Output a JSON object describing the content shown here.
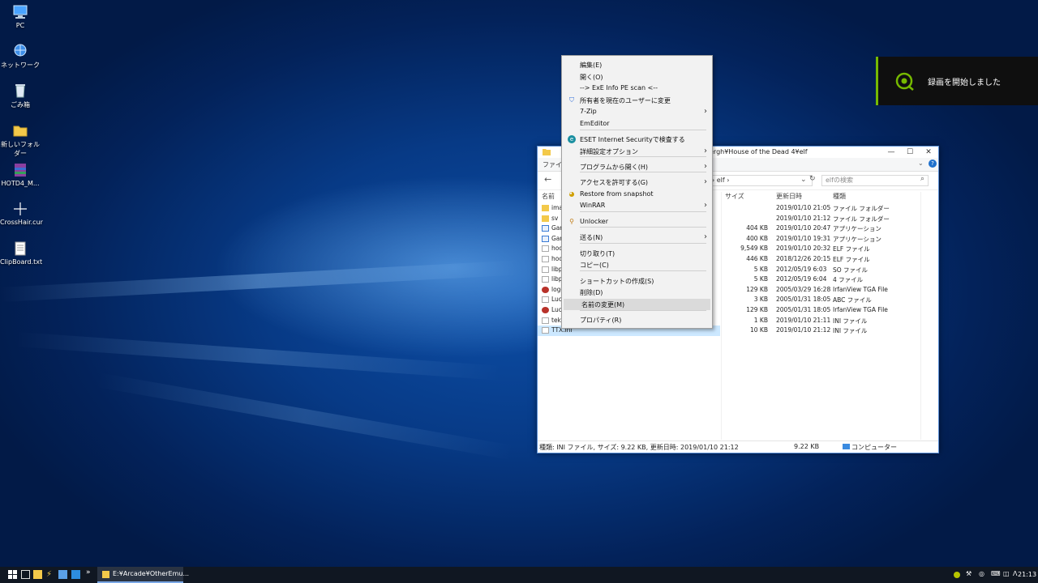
{
  "desktop": {
    "icons": [
      {
        "label": "PC",
        "icon": "pc-icon"
      },
      {
        "label": "ネットワーク",
        "icon": "network-icon"
      },
      {
        "label": "ごみ箱",
        "icon": "recycle-bin-icon"
      },
      {
        "label": "新しいフォルダー",
        "icon": "folder-icon"
      },
      {
        "label": "HOTD4_M...",
        "icon": "winrar-archive-icon"
      },
      {
        "label": "CrossHair.cur",
        "icon": "cursor-file-icon"
      },
      {
        "label": "ClipBoard.txt",
        "icon": "text-file-icon"
      }
    ]
  },
  "explorer": {
    "title_path": "ergh¥House of the Dead 4¥elf",
    "ribbon_file": "ファイル",
    "address_tail": "elf",
    "search_placeholder": "elfの検索",
    "columns": {
      "name": "名前",
      "size": "サイズ",
      "date": "更新日時",
      "type": "種類"
    },
    "files": [
      {
        "name": "ima",
        "size": "",
        "date": "2019/01/10 21:05",
        "type": "ファイル フォルダー",
        "icon": "folder"
      },
      {
        "name": "sv",
        "size": "",
        "date": "2019/01/10 21:12",
        "type": "ファイル フォルダー",
        "icon": "folder"
      },
      {
        "name": "Gar",
        "size": "404 KB",
        "date": "2019/01/10 20:47",
        "type": "アプリケーション",
        "icon": "app"
      },
      {
        "name": "Gar",
        "size": "400 KB",
        "date": "2019/01/10 19:31",
        "type": "アプリケーション",
        "icon": "app"
      },
      {
        "name": "hoc",
        "size": "9,549 KB",
        "date": "2019/01/10 20:32",
        "type": "ELF ファイル",
        "icon": "file"
      },
      {
        "name": "hoc",
        "size": "446 KB",
        "date": "2018/12/26 20:15",
        "type": "ELF ファイル",
        "icon": "file"
      },
      {
        "name": "libp",
        "size": "5 KB",
        "date": "2012/05/19 6:03",
        "type": "SO ファイル",
        "icon": "file"
      },
      {
        "name": "libp",
        "size": "5 KB",
        "date": "2012/05/19 6:04",
        "type": "4 ファイル",
        "icon": "file"
      },
      {
        "name": "logo",
        "size": "129 KB",
        "date": "2005/03/29 16:28",
        "type": "IrfanView TGA File",
        "icon": "tga"
      },
      {
        "name": "Luc",
        "size": "3 KB",
        "date": "2005/01/31 18:05",
        "type": "ABC ファイル",
        "icon": "file"
      },
      {
        "name": "Luc",
        "size": "129 KB",
        "date": "2005/01/31 18:05",
        "type": "IrfanView TGA File",
        "icon": "tga"
      },
      {
        "name": "tekr",
        "size": "1 KB",
        "date": "2019/01/10 21:11",
        "type": "INI ファイル",
        "icon": "file"
      },
      {
        "name": "TTX.ini",
        "size": "10 KB",
        "date": "2019/01/10 21:12",
        "type": "INI ファイル",
        "icon": "file"
      }
    ],
    "status_left": "種類: INI ファイル, サイズ: 9.22 KB, 更新日時: 2019/01/10 21:12",
    "status_size": "9.22 KB",
    "status_location": "コンピューター"
  },
  "context_menu": {
    "items": [
      {
        "label": "編集(E)"
      },
      {
        "label": "開く(O)"
      },
      {
        "label": "--> ExE Info  PE scan  <--"
      },
      {
        "label": "所有者を現在のユーザーに変更",
        "icon": "uac-shield-icon"
      },
      {
        "label": "7-Zip",
        "submenu": true
      },
      {
        "label": "EmEditor"
      },
      {
        "label": "ESET Internet Securityで検査する",
        "icon": "eset-icon"
      },
      {
        "label": "詳細設定オプション",
        "submenu": true
      },
      {
        "label": "プログラムから開く(H)",
        "submenu": true
      },
      {
        "label": "アクセスを許可する(G)",
        "submenu": true
      },
      {
        "label": "Restore from snapshot",
        "icon": "snapshot-icon"
      },
      {
        "label": "WinRAR",
        "submenu": true
      },
      {
        "label": "Unlocker",
        "icon": "unlocker-icon"
      },
      {
        "label": "送る(N)",
        "submenu": true
      },
      {
        "label": "切り取り(T)"
      },
      {
        "label": "コピー(C)"
      },
      {
        "label": "ショートカットの作成(S)"
      },
      {
        "label": "削除(D)"
      },
      {
        "label": "名前の変更(M)",
        "highlighted": true
      },
      {
        "label": "プロパティ(R)"
      }
    ]
  },
  "toast": {
    "message": "録画を開始しました",
    "icon": "recording-icon"
  },
  "taskbar": {
    "task_label": "E:¥Arcade¥OtherEmu...",
    "clock": "21:13"
  },
  "colors": {
    "accent": "#76b900",
    "selection": "#cce8ff",
    "taskbar": "#101722"
  }
}
